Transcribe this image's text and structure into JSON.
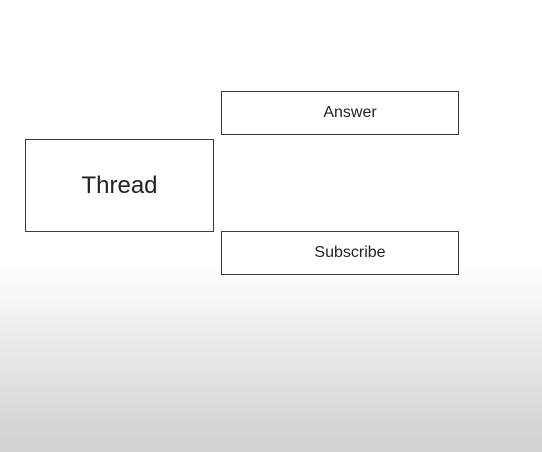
{
  "diagram": {
    "nodes": {
      "thread": "Thread",
      "answer": "Answer",
      "subscribe": "Subscribe"
    }
  }
}
